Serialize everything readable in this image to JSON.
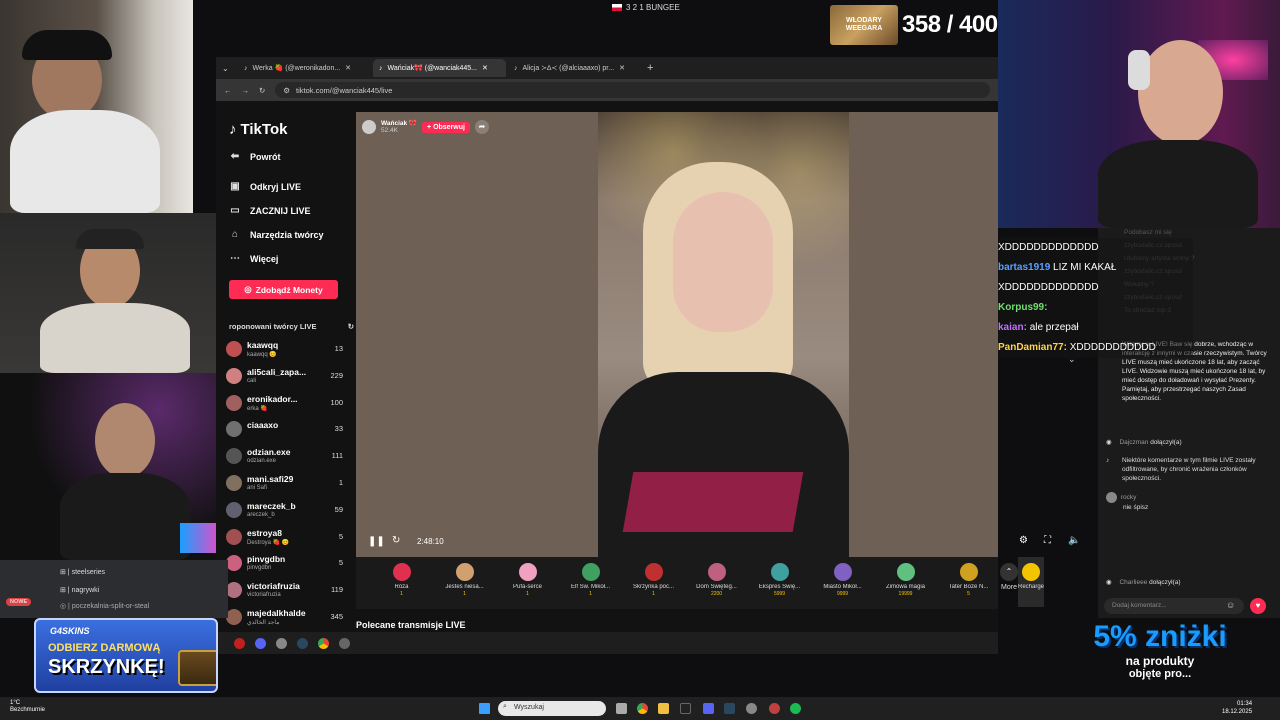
{
  "stream_overlay": {
    "top_title": "3 2 1 BUNGEE",
    "sub_thumb_text": "WŁODARY WEEGARA",
    "sub_count": "358 / 400",
    "promo_left_line1": "ODBIERZ DARMOWĄ",
    "promo_left_line2": "SKRZYNKĘ!",
    "promo_left_brand": "G4SKINS",
    "promo_right_big": "5% zniżki",
    "promo_right_line1": "na produkty",
    "promo_right_line2": "objęte pro..."
  },
  "browser": {
    "tabs": [
      {
        "label": "Werka 🍓 (@weronikadon..."
      },
      {
        "label": "Wańciak🎀 (@wanciak445..."
      },
      {
        "label": "Alicja ≻∆≺ (@alciaaaxo) pr..."
      }
    ],
    "url": "tiktok.com/@wanciak445/live"
  },
  "tiktok": {
    "logo": "TikTok",
    "nav": {
      "back": "Powrót",
      "discover": "Odkryj LIVE",
      "start": "ZACZNIJ LIVE",
      "tools": "Narzędzia twórcy",
      "more": "Więcej"
    },
    "coins_button": "Zdobądź Monety",
    "recommended_title": "roponowani twórcy LIVE",
    "creators": [
      {
        "name": "kaawqq",
        "sub": "kaawqq 😊",
        "count": "13"
      },
      {
        "name": "ali5cali_zapa...",
        "sub": "cali",
        "count": "229"
      },
      {
        "name": "eronikador...",
        "sub": "erka 🍓",
        "count": "100"
      },
      {
        "name": "ciaaaxo",
        "sub": "",
        "count": "33"
      },
      {
        "name": "odzian.exe",
        "sub": "odzian.exe",
        "count": "111"
      },
      {
        "name": "mani.safi29",
        "sub": "ani Safi",
        "count": "1"
      },
      {
        "name": "mareczek_b",
        "sub": "areczek_b",
        "count": "59"
      },
      {
        "name": "estroya8",
        "sub": "Destroya 🍓 😊",
        "count": "5"
      },
      {
        "name": "pinvgdbn",
        "sub": "pinvgdbn",
        "count": "5"
      },
      {
        "name": "victoriafruzia",
        "sub": "victoriafruzia",
        "count": "119"
      },
      {
        "name": "majedalkhalde",
        "sub": "ماجد الخالدي",
        "count": "345"
      }
    ],
    "host_name": "Wańciak 🎀",
    "host_likes": "52.4K",
    "follow_button": "+ Obserwuj",
    "time": "2:48:10",
    "gifts": [
      {
        "name": "Róża",
        "price": "1"
      },
      {
        "name": "Jesteś niesa...",
        "price": "1"
      },
      {
        "name": "Pufa-serce",
        "price": "1"
      },
      {
        "name": "Elf Św. Mikoł...",
        "price": "1"
      },
      {
        "name": "Skrzynka poc...",
        "price": "1"
      },
      {
        "name": "Dom Święteg...",
        "price": "2200"
      },
      {
        "name": "Ekspres Świę...",
        "price": "5999"
      },
      {
        "name": "Miasto Mikoł...",
        "price": "9999"
      },
      {
        "name": "Zimowa magia",
        "price": "19999"
      },
      {
        "name": "Tater Boże N...",
        "price": "5"
      }
    ],
    "more_label": "More",
    "recharge_label": "Recharge",
    "recommended_streams": "Polecane transmisje LIVE",
    "chat": {
      "faded": [
        "Podobasz mi się",
        "zzybodalic.cz.sposd",
        "Ulubiony artysta wolny ?",
        "zzybodalic.cz.sposd",
        "Wokalny ?",
        "zzybodalic.cz.sposd",
        "To chociaż top 3"
      ],
      "notice": "Witamy w LIVE! Baw się dobrze, wchodząc w interakcję z innymi w czasie rzeczywistym. Twórcy LIVE muszą mieć ukończone 18 lat, aby zacząć LIVE. Widzowie muszą mieć ukończone 18 lat, by mieć dostęp do doładowań i wysyłać Prezenty. Pamiętaj, aby przestrzegać naszych Zasad społeczności.",
      "join1_user": "Dajczman",
      "join1_text": "dołączył(a)",
      "filter_notice": "Niektóre komentarze w tym filmie LIVE zostały odfiltrowane, by chronić wrażenia członków społeczności.",
      "rocky_user": "rocky",
      "rocky_text": "nie śpisz",
      "join2_user": "Charlieee",
      "join2_text": "dołączył(a)",
      "input_placeholder": "Dodaj komentarz..."
    }
  },
  "stream_chat_overlay": [
    {
      "user": "",
      "text": "XDDDDDDDDDDDDD"
    },
    {
      "user": "bartas1919",
      "text": "LIZ MI KAKAŁ",
      "color": "#5aa0ff"
    },
    {
      "user": "",
      "text": "XDDDDDDDDDDDDD"
    },
    {
      "user": "Korpus99:",
      "text": "",
      "color": "#6fe06f"
    },
    {
      "user": "kaian:",
      "text": "ale przepał",
      "color": "#c06fff"
    },
    {
      "user": "PanDamian77:",
      "text": "XDDDDDDDDDDD",
      "color": "#ffd24a"
    }
  ],
  "discord": {
    "channels": [
      "steelseries",
      "nagrywki",
      "poczekalnia-split-or-steal"
    ],
    "badge": "NOWE"
  },
  "taskbar": {
    "weather_temp": "1°C",
    "weather_desc": "Bezchmurnie",
    "search_placeholder": "Wyszukaj",
    "time": "01:34",
    "date": "18.12.2025"
  }
}
